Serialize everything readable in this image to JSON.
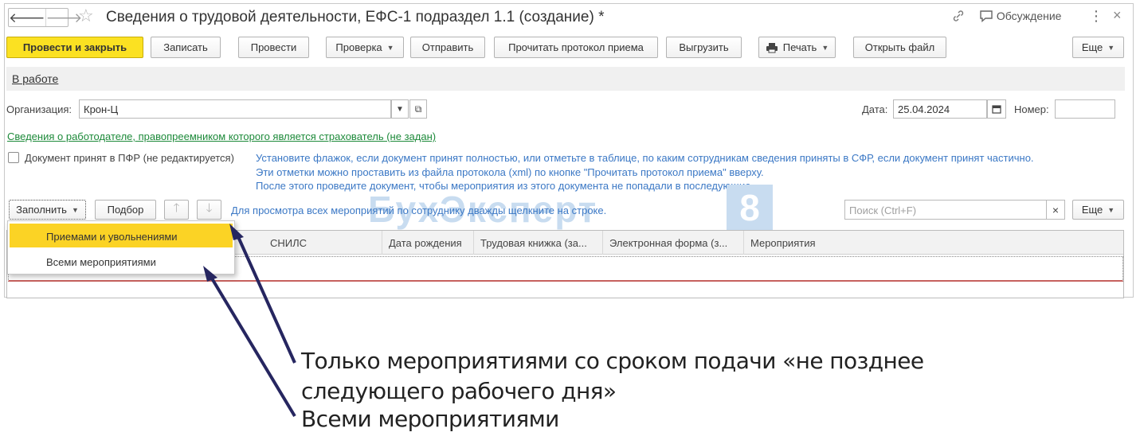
{
  "window": {
    "title": "Сведения о трудовой деятельности, ЕФС-1 подраздел 1.1 (создание) *",
    "discussion_label": "Обсуждение",
    "more_glyph": "⋮",
    "close_glyph": "×",
    "back_glyph": "🡐",
    "forward_glyph": "🡒"
  },
  "toolbar": {
    "post_close": "Провести и закрыть",
    "save": "Записать",
    "post": "Провести",
    "check": "Проверка",
    "send": "Отправить",
    "read_protocol": "Прочитать протокол приема",
    "export": "Выгрузить",
    "print": "Печать",
    "open_file": "Открыть файл",
    "more": "Еще"
  },
  "status": {
    "label": "В работе"
  },
  "form": {
    "org_label": "Организация:",
    "org_value": "Крон-Ц",
    "date_label": "Дата:",
    "date_value": "25.04.2024",
    "number_label": "Номер:",
    "number_value": "",
    "employer_link": "Сведения о работодателе, правопреемником которого является страхователь (не задан)",
    "pfr_checkbox_label": "Документ принят в ПФР (не редактируется)",
    "hint_lines": [
      "Установите флажок, если документ принят полностью, или отметьте в таблице, по каким сотрудникам сведения приняты в СФР, если документ принят частично.",
      "Эти отметки можно проставить из файла протокола (xml) по кнопке \"Прочитать протокол приема\" вверху.",
      "После этого проведите документ, чтобы мероприятия из этого документа не попадали в последующие."
    ]
  },
  "table_toolbar": {
    "fill": "Заполнить",
    "pick": "Подбор",
    "up_glyph": "🡑",
    "down_glyph": "🡓",
    "hint": "Для просмотра всех мероприятий по сотруднику дважды щелкните на строке.",
    "search_placeholder": "Поиск (Ctrl+F)",
    "clear_glyph": "×",
    "more": "Еще"
  },
  "table": {
    "columns": [
      "СНИЛС",
      "Дата рождения",
      "Трудовая книжка (за...",
      "Электронная форма (з...",
      "Мероприятия"
    ]
  },
  "dropdown": {
    "items": [
      "Приемами и увольнениями",
      "Всеми мероприятиями"
    ]
  },
  "watermark": {
    "text": "БухЭксперт",
    "digit": "8"
  },
  "annotations": {
    "line1": "Только мероприятиями со сроком подачи «не позднее",
    "line2": "следующего рабочего дня»",
    "line3": "Всеми мероприятиями"
  },
  "colors": {
    "primary_button": "#fbe122",
    "active_item": "#fbd325",
    "link_green": "#1d8a3a",
    "hint_blue": "#3b78c5",
    "arrow": "#262660"
  }
}
